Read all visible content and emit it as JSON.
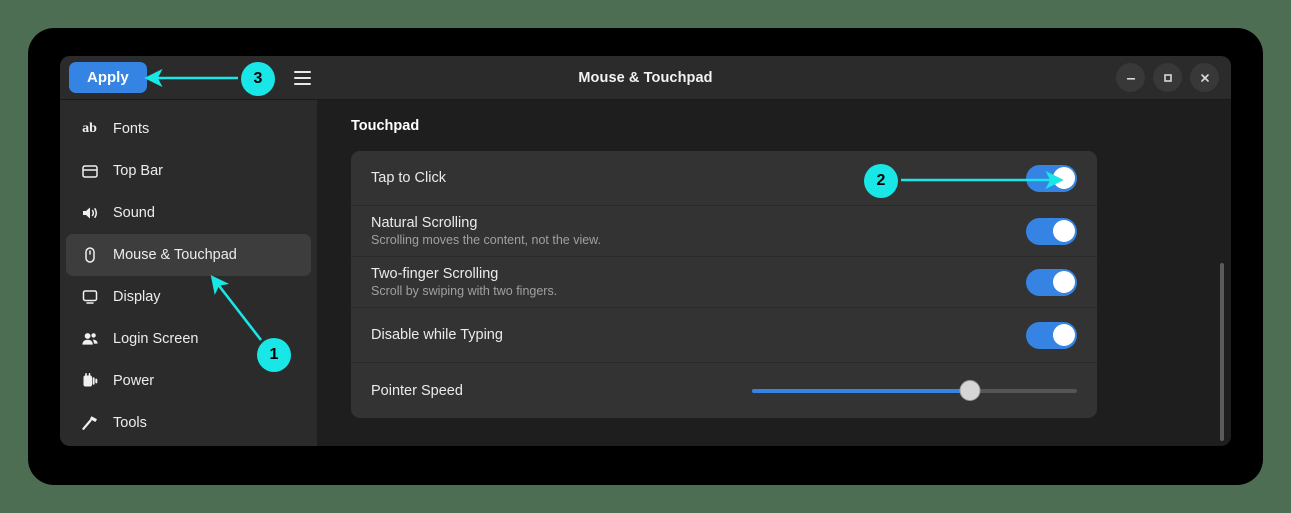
{
  "desktop": {
    "background_color": "#4d6e52",
    "frame_color": "#000000"
  },
  "window": {
    "title": "Mouse & Touchpad",
    "background_color": "#1e1e1e",
    "header_color": "#2b2b2b",
    "accent_color": "#3584e4"
  },
  "header": {
    "apply_label": "Apply",
    "menu_icon": "hamburger-menu-icon",
    "controls": [
      {
        "name": "minimize",
        "icon": "minimize-icon"
      },
      {
        "name": "maximize",
        "icon": "maximize-icon"
      },
      {
        "name": "close",
        "icon": "close-icon"
      }
    ]
  },
  "sidebar": {
    "items": [
      {
        "label": "Fonts",
        "icon": "fonts-ab-icon",
        "selected": false
      },
      {
        "label": "Top Bar",
        "icon": "top-bar-icon",
        "selected": false
      },
      {
        "label": "Sound",
        "icon": "sound-speaker-icon",
        "selected": false
      },
      {
        "label": "Mouse & Touchpad",
        "icon": "mouse-icon",
        "selected": true
      },
      {
        "label": "Display",
        "icon": "display-monitor-icon",
        "selected": false
      },
      {
        "label": "Login Screen",
        "icon": "users-icon",
        "selected": false
      },
      {
        "label": "Power",
        "icon": "power-plug-icon",
        "selected": false
      },
      {
        "label": "Tools",
        "icon": "hammer-tool-icon",
        "selected": false
      }
    ]
  },
  "content": {
    "section_title": "Touchpad",
    "rows": [
      {
        "title": "Tap to Click",
        "subtitle": "",
        "control": "toggle",
        "value": "on"
      },
      {
        "title": "Natural Scrolling",
        "subtitle": "Scrolling moves the content, not the view.",
        "control": "toggle",
        "value": "on"
      },
      {
        "title": "Two-finger Scrolling",
        "subtitle": "Scroll by swiping with two fingers.",
        "control": "toggle",
        "value": "on"
      },
      {
        "title": "Disable while Typing",
        "subtitle": "",
        "control": "toggle",
        "value": "on"
      },
      {
        "title": "Pointer Speed",
        "subtitle": "",
        "control": "slider",
        "value": 67
      }
    ]
  },
  "annotations": {
    "color": "#19e6e6",
    "markers": [
      {
        "label": "1",
        "target": "sidebar-item-mouse-touchpad"
      },
      {
        "label": "2",
        "target": "tap-to-click-toggle"
      },
      {
        "label": "3",
        "target": "apply-button"
      }
    ]
  }
}
